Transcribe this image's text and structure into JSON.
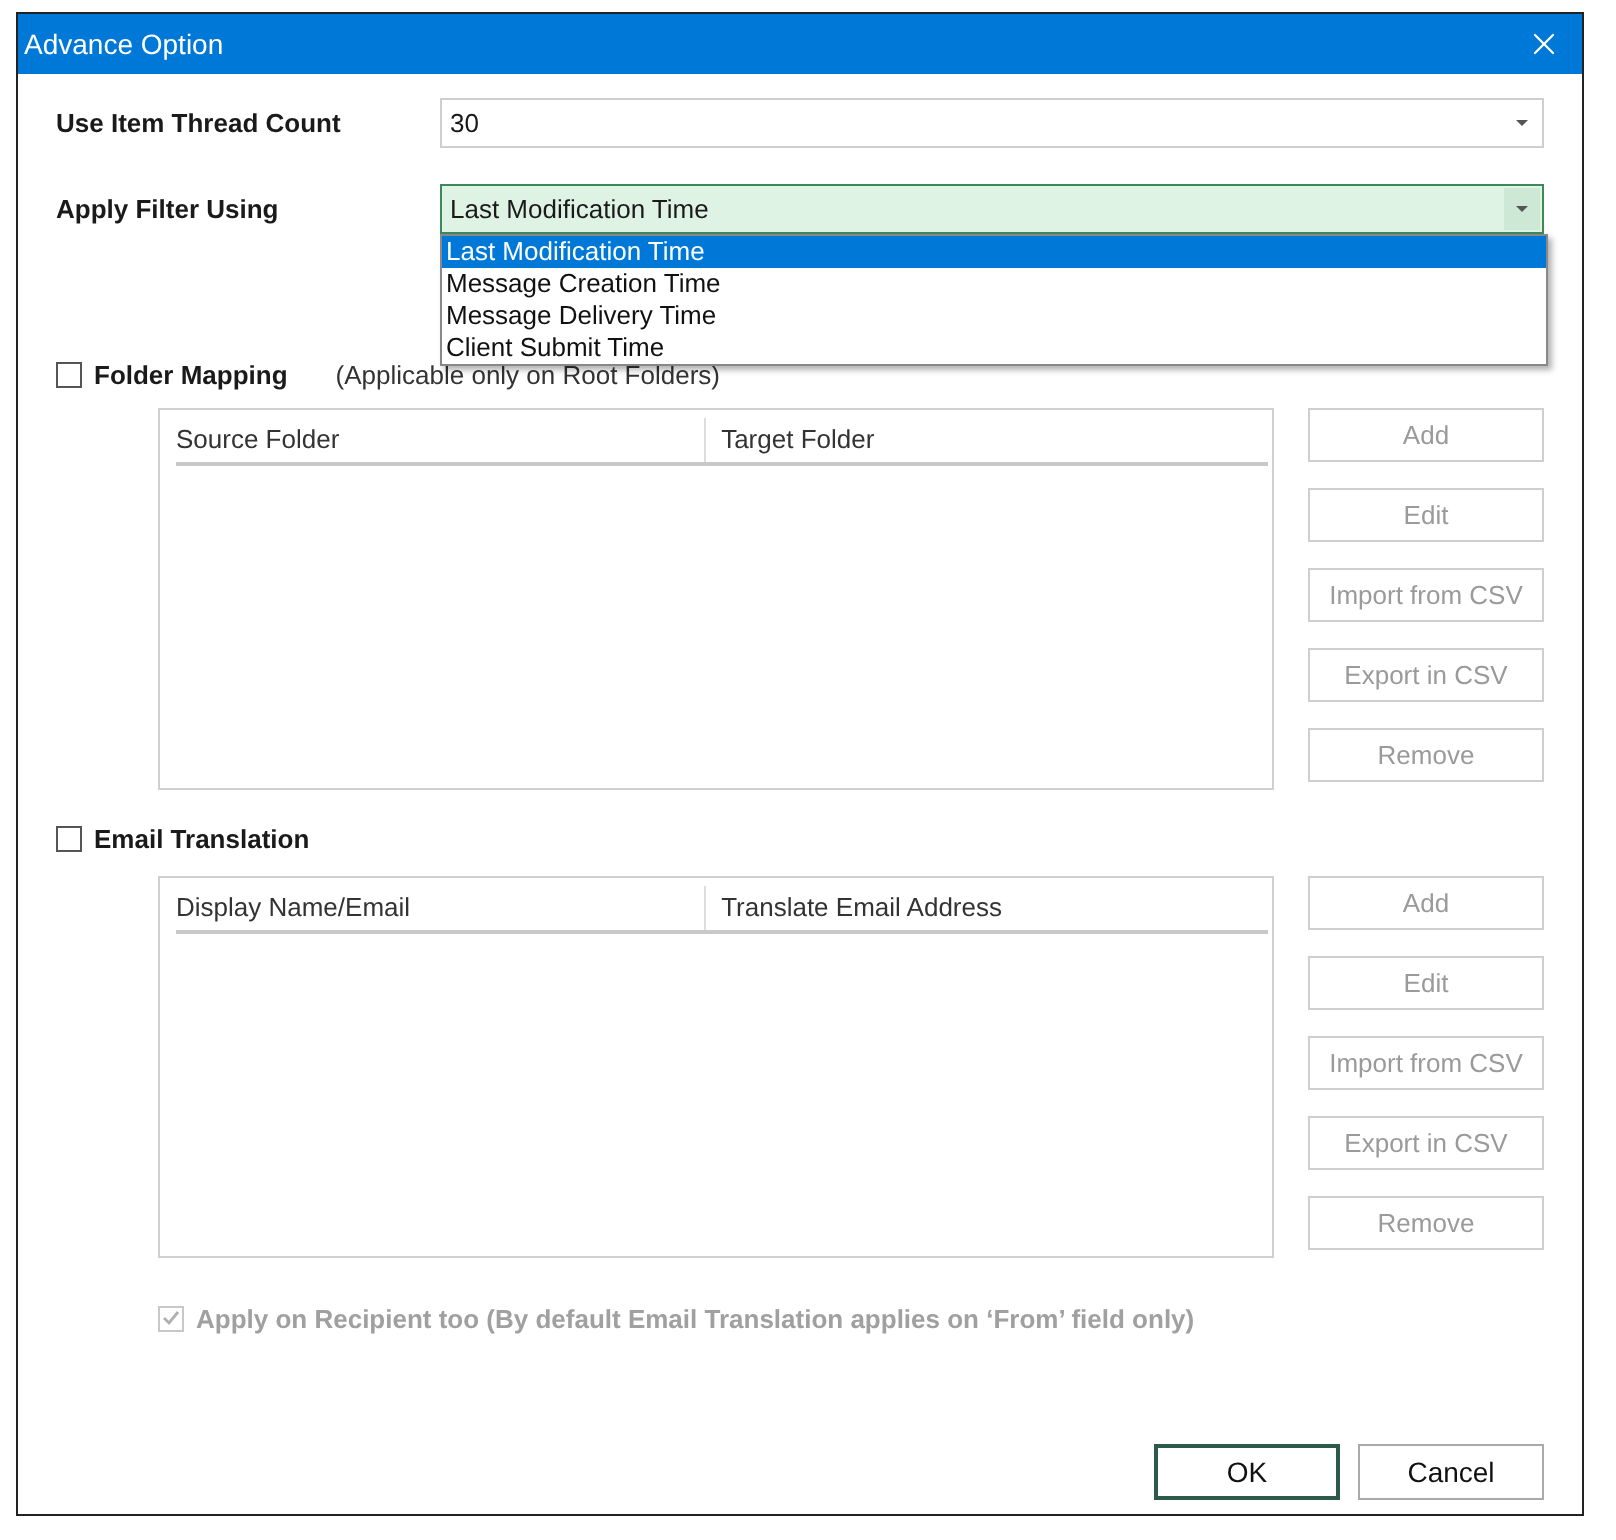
{
  "window": {
    "title": "Advance Option"
  },
  "thread_count": {
    "label": "Use Item Thread Count",
    "value": "30"
  },
  "filter": {
    "label": "Apply Filter Using",
    "value": "Last Modification Time",
    "expanded": true,
    "options": [
      {
        "label": "Last Modification Time",
        "selected": true
      },
      {
        "label": "Message Creation Time",
        "selected": false
      },
      {
        "label": "Message Delivery Time",
        "selected": false
      },
      {
        "label": "Client Submit Time",
        "selected": false
      }
    ]
  },
  "sections": [
    {
      "label": "Folder Mapping",
      "checked": false,
      "note": "(Applicable only on Root Folders)",
      "columns": [
        "Source Folder",
        "Target Folder"
      ],
      "buttons": [
        {
          "label": "Add",
          "disabled": true
        },
        {
          "label": "Edit",
          "disabled": true
        },
        {
          "label": "Import from CSV",
          "disabled": true
        },
        {
          "label": "Export in CSV",
          "disabled": true
        },
        {
          "label": "Remove",
          "disabled": true
        }
      ]
    },
    {
      "label": "Email Translation",
      "checked": false,
      "columns": [
        "Display Name/Email",
        "Translate Email Address"
      ],
      "buttons": [
        {
          "label": "Add",
          "disabled": true
        },
        {
          "label": "Edit",
          "disabled": true
        },
        {
          "label": "Import from CSV",
          "disabled": true
        },
        {
          "label": "Export in CSV",
          "disabled": true
        },
        {
          "label": "Remove",
          "disabled": true
        }
      ]
    }
  ],
  "recipient_option": {
    "label": "Apply on Recipient too (By default Email Translation applies on ‘From’ field only)",
    "checked": true,
    "disabled": true
  },
  "footer_buttons": [
    {
      "label": "OK",
      "default": true
    },
    {
      "label": "Cancel",
      "default": false
    }
  ]
}
